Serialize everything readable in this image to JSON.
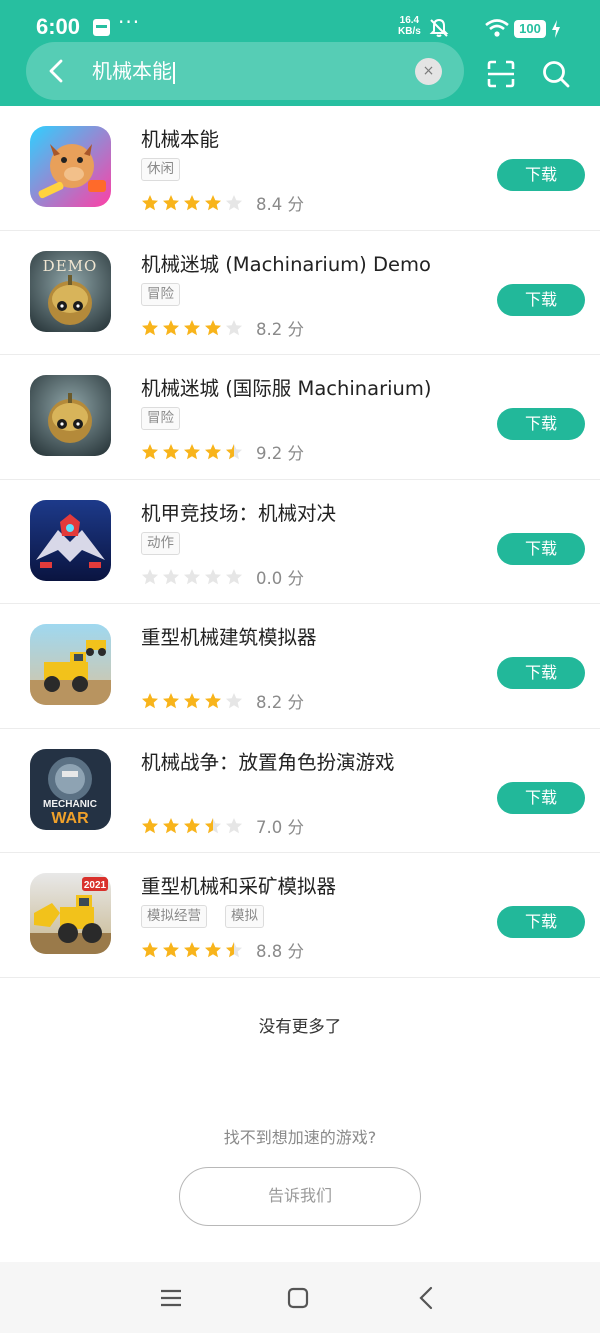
{
  "status_bar": {
    "time": "6:00",
    "more": "···",
    "speed_value": "16.4",
    "speed_unit": "KB/s",
    "battery": "100"
  },
  "search": {
    "query": "机械本能",
    "clear": "×"
  },
  "colors": {
    "accent": "#27bfa0",
    "button": "#22b89a",
    "star": "#f8b41b",
    "star_empty": "#e6e6e6"
  },
  "results": [
    {
      "name": "机械本能",
      "tags": [
        "休闲"
      ],
      "stars": 4,
      "score": "8.4 分",
      "download": "下载",
      "icon": "pig-warrior-game-icon"
    },
    {
      "name": "机械迷城 (Machinarium) Demo",
      "tags": [
        "冒险"
      ],
      "stars": 4,
      "score": "8.2 分",
      "download": "下载",
      "icon": "robot-demo-game-icon",
      "icon_text": "DEMO"
    },
    {
      "name": "机械迷城 (国际服 Machinarium)",
      "tags": [
        "冒险"
      ],
      "stars": 4.5,
      "score": "9.2 分",
      "download": "下载",
      "icon": "robot-game-icon"
    },
    {
      "name": "机甲竞技场：机械对决",
      "tags": [
        "动作"
      ],
      "stars": 0,
      "score": "0.0 分",
      "download": "下载",
      "icon": "mech-arena-game-icon"
    },
    {
      "name": "重型机械建筑模拟器",
      "tags": [],
      "stars": 4,
      "score": "8.2 分",
      "download": "下载",
      "icon": "construction-vehicle-game-icon"
    },
    {
      "name": "机械战争：放置角色扮演游戏",
      "tags": [],
      "stars": 3.5,
      "score": "7.0 分",
      "download": "下载",
      "icon": "mechanic-war-game-icon",
      "icon_text": "MECHANIC WAR"
    },
    {
      "name": "重型机械和采矿模拟器",
      "tags": [
        "模拟经营",
        "模拟"
      ],
      "stars": 4.5,
      "score": "8.8 分",
      "download": "下载",
      "icon": "wheel-loader-game-icon",
      "icon_text": "2021"
    }
  ],
  "footer": {
    "no_more": "没有更多了",
    "cant_find": "找不到想加速的游戏?",
    "tell_us": "告诉我们"
  }
}
